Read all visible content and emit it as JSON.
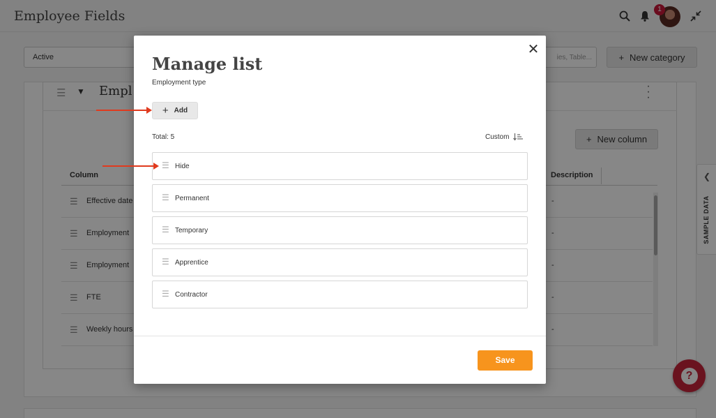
{
  "app": {
    "title": "Employee Fields",
    "notification_count": "1"
  },
  "filters": {
    "status_value": "Active",
    "search_placeholder": "ies, Table...",
    "new_category_label": "New category"
  },
  "category": {
    "title": "Empl",
    "new_column_label": "New column",
    "columns": {
      "column_header": "Column",
      "description_header": "Description"
    },
    "rows": [
      {
        "name": "Effective date",
        "description": "-"
      },
      {
        "name": "Employment",
        "description": "-"
      },
      {
        "name": "Employment",
        "description": "-"
      },
      {
        "name": "FTE",
        "description": "-"
      },
      {
        "name": "Weekly hours",
        "description": "-"
      }
    ]
  },
  "sample_data": {
    "label": "SAMPLE DATA"
  },
  "modal": {
    "title": "Manage list",
    "subtitle": "Employment type",
    "add_label": "Add",
    "total_label": "Total: 5",
    "sort_label": "Custom",
    "items": [
      {
        "label": "Hide"
      },
      {
        "label": "Permanent"
      },
      {
        "label": "Temporary"
      },
      {
        "label": "Apprentice"
      },
      {
        "label": "Contractor"
      }
    ],
    "save_label": "Save"
  },
  "colors": {
    "accent": "#f7941d",
    "help": "#c8243b",
    "annotation_arrow": "#e03a1e"
  },
  "icons": {
    "search": "search-icon",
    "bell": "bell-icon",
    "collapse": "collapse-icon",
    "close": "close-icon",
    "drag": "drag-handle-icon",
    "sort": "sort-icon",
    "help": "help-icon"
  }
}
